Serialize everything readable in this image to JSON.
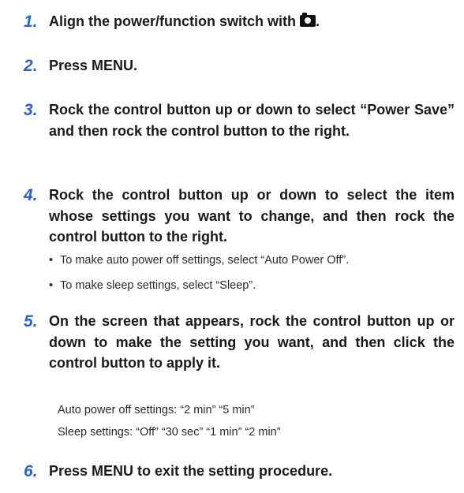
{
  "steps": [
    {
      "number": "1.",
      "text": "Align the power/function switch with",
      "suffix": "."
    },
    {
      "number": "2.",
      "text": "Press MENU."
    },
    {
      "number": "3.",
      "text": "Rock the control button up or down to select “Power Save” and then rock the control button to the right."
    },
    {
      "number": "4.",
      "text": "Rock the control button up or down to select the item whose settings you want to change, and then rock the control button to the right."
    },
    {
      "number": "5.",
      "text": "On the screen that appears, rock the control button up or down to make the setting you want, and then click the control button to apply it."
    },
    {
      "number": "6.",
      "text": "Press MENU to exit the setting procedure."
    }
  ],
  "step4_bullets": [
    "To make auto power off settings, select “Auto Power Off”.",
    "To make sleep settings, select “Sleep”."
  ],
  "step5_notes": [
    "Auto power off settings: “2 min” “5 min”",
    "Sleep settings: “Off” “30 sec” “1 min” “2 min”"
  ],
  "icons": {
    "camera": "camera-mode-icon"
  },
  "colors": {
    "step_number": "#2a62c9",
    "text": "#1a1a1a"
  }
}
